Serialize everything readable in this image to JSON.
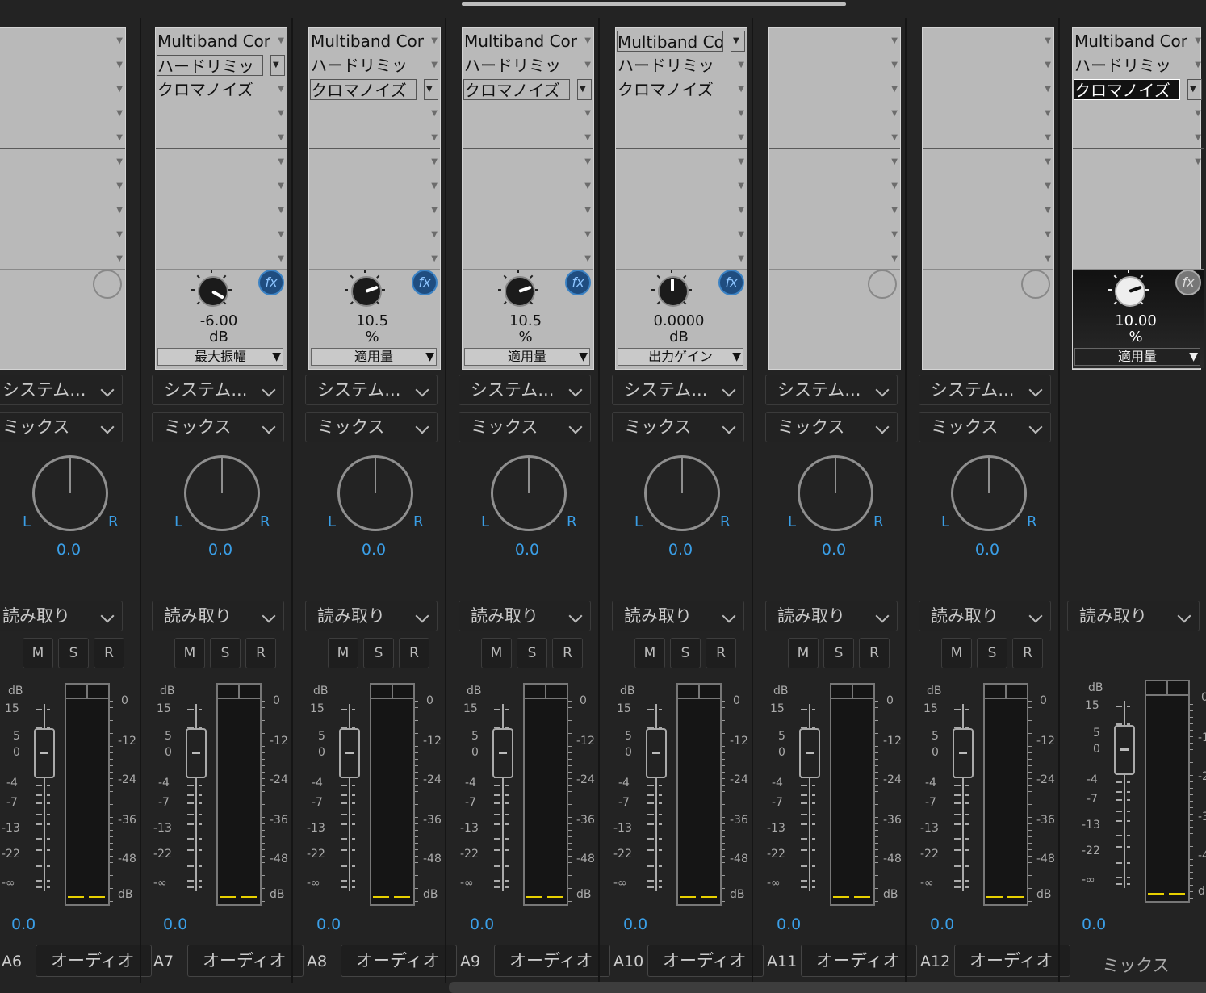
{
  "mixer": {
    "channels": [
      {
        "name": "A6",
        "track": "オーディオ",
        "slots": [
          "",
          "",
          "",
          "",
          "",
          "",
          "",
          "",
          "",
          ""
        ],
        "param": null,
        "system": "システム...",
        "mix": "ミックス",
        "pan": "0.0",
        "auto": "読み取り",
        "volume": "0.0"
      },
      {
        "name": "A7",
        "track": "オーディオ",
        "slots": [
          "Multiband Con",
          "ハードリミッ",
          "クロマノイズ",
          "",
          "",
          "",
          "",
          "",
          "",
          ""
        ],
        "param": {
          "value": "-6.00",
          "unit": "dB",
          "name": "最大振幅",
          "angle": 30
        },
        "system": "システム...",
        "mix": "ミックス",
        "pan": "0.0",
        "auto": "読み取り",
        "volume": "0.0"
      },
      {
        "name": "A8",
        "track": "オーディオ",
        "slots": [
          "Multiband Con",
          "ハードリミッ",
          "クロマノイズ",
          "",
          "",
          "",
          "",
          "",
          "",
          ""
        ],
        "param": {
          "value": "10.5",
          "unit": "%",
          "name": "適用量",
          "angle": -20
        },
        "system": "システム...",
        "mix": "ミックス",
        "pan": "0.0",
        "auto": "読み取り",
        "volume": "0.0"
      },
      {
        "name": "A9",
        "track": "オーディオ",
        "slots": [
          "Multiband Con",
          "ハードリミッ",
          "クロマノイズ",
          "",
          "",
          "",
          "",
          "",
          "",
          ""
        ],
        "param": {
          "value": "10.5",
          "unit": "%",
          "name": "適用量",
          "angle": -20
        },
        "system": "システム...",
        "mix": "ミックス",
        "pan": "0.0",
        "auto": "読み取り",
        "volume": "0.0"
      },
      {
        "name": "A10",
        "track": "オーディオ",
        "slots": [
          "Multiband Con",
          "ハードリミッ",
          "クロマノイズ",
          "",
          "",
          "",
          "",
          "",
          "",
          ""
        ],
        "param": {
          "value": "0.0000",
          "unit": "dB",
          "name": "出力ゲイン",
          "angle": -90
        },
        "system": "システム...",
        "mix": "ミックス",
        "pan": "0.0",
        "auto": "読み取り",
        "volume": "0.0"
      },
      {
        "name": "A11",
        "track": "オーディオ",
        "slots": [
          "",
          "",
          "",
          "",
          "",
          "",
          "",
          "",
          "",
          ""
        ],
        "param": null,
        "system": "システム...",
        "mix": "ミックス",
        "pan": "0.0",
        "auto": "読み取り",
        "volume": "0.0"
      },
      {
        "name": "A12",
        "track": "オーディオ",
        "slots": [
          "",
          "",
          "",
          "",
          "",
          "",
          "",
          "",
          "",
          ""
        ],
        "param": null,
        "system": "システム...",
        "mix": "ミックス",
        "pan": "0.0",
        "auto": "読み取り",
        "volume": "0.0"
      }
    ],
    "master": {
      "label": "ミックス",
      "slots": [
        "Multiband Con",
        "ハードリミッ",
        "クロマノイズ",
        "",
        "",
        ""
      ],
      "param": {
        "value": "10.00",
        "unit": "%",
        "name": "適用量",
        "angle": -20
      },
      "auto": "読み取り",
      "volume": "0.0"
    },
    "buttons": {
      "mute": "M",
      "solo": "S",
      "record": "R"
    },
    "fader_scale": [
      "dB",
      "15",
      "5",
      "0",
      "-4",
      "-7",
      "-13",
      "-22",
      "-∞"
    ],
    "meter_scale": [
      "0",
      "-12",
      "-24",
      "-36",
      "-48",
      "dB"
    ],
    "pan_left": "L",
    "pan_right": "R",
    "fx_label": "fx"
  }
}
